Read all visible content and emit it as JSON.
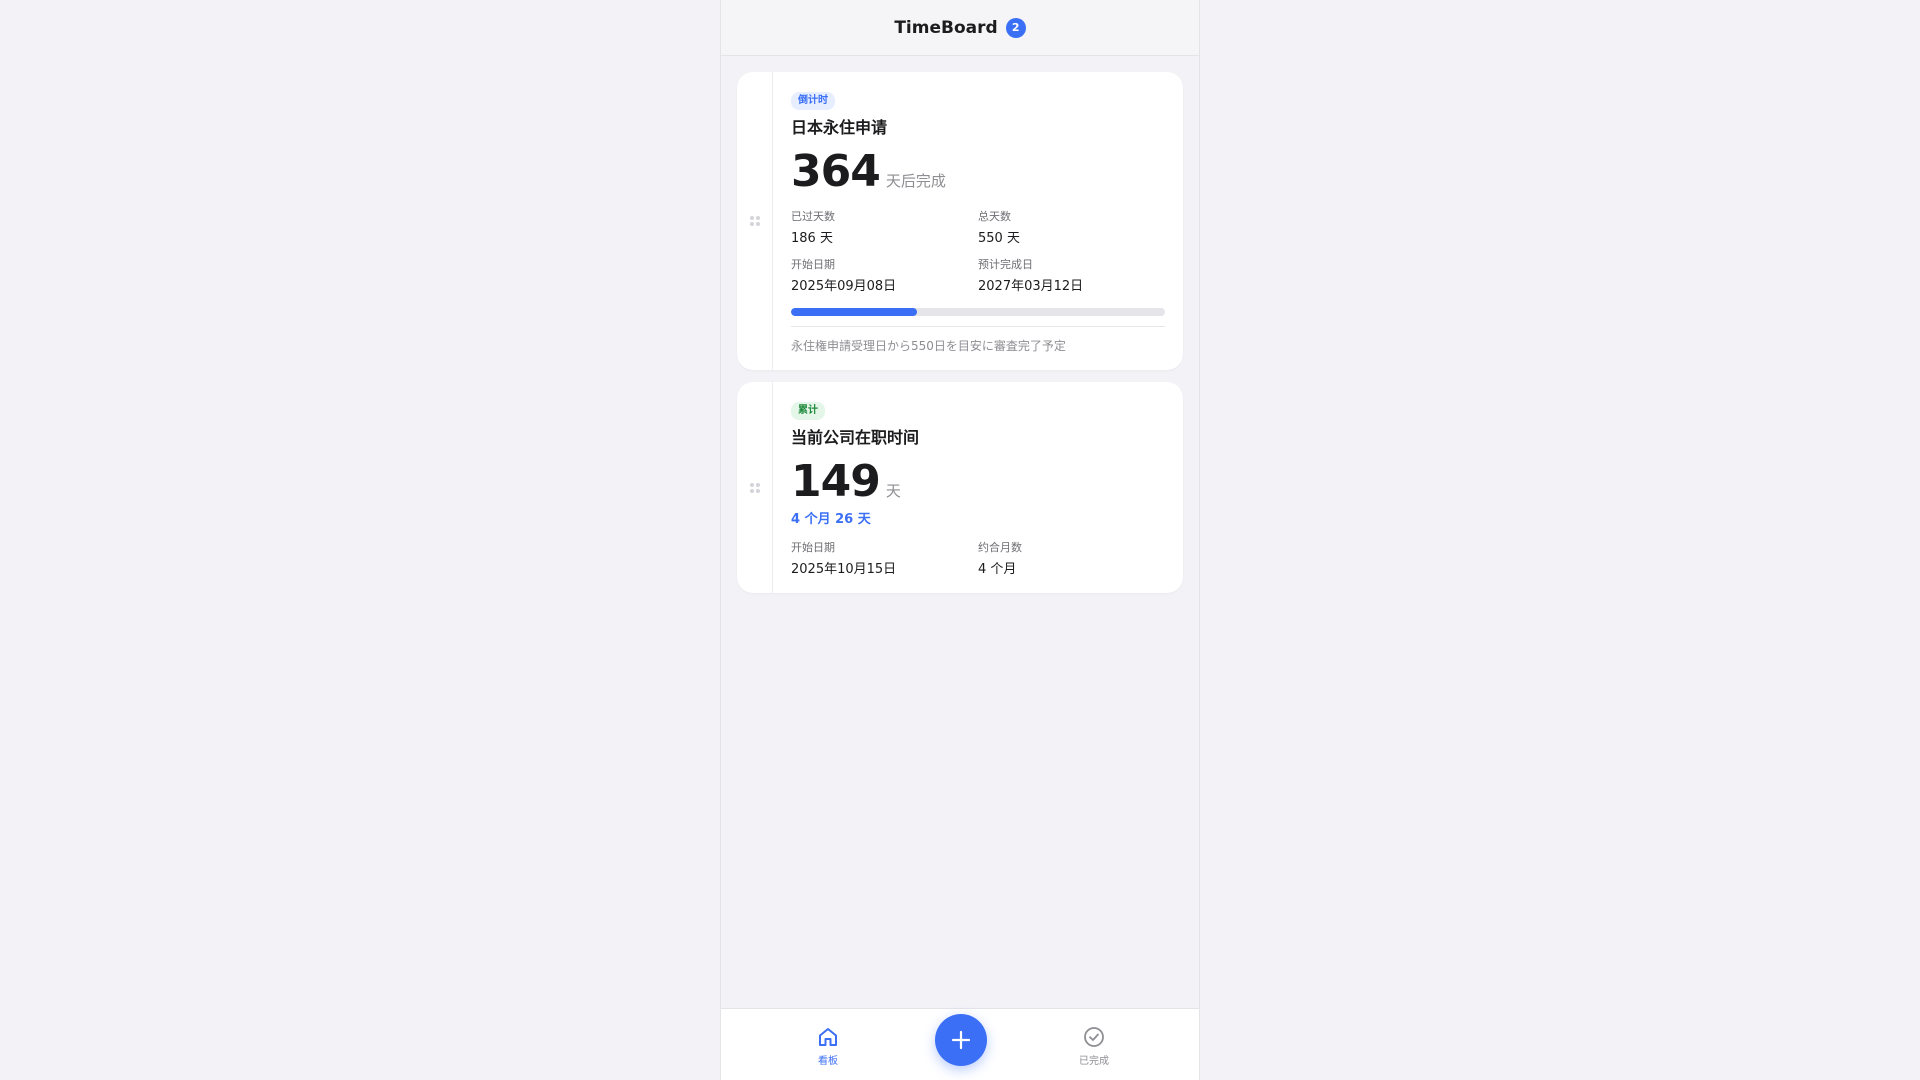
{
  "header": {
    "title": "TimeBoard",
    "badge": "2"
  },
  "cards": [
    {
      "tag": "倒计时",
      "title": "日本永住申请",
      "big_number": "364",
      "big_unit": "天后完成",
      "info": [
        {
          "label": "已过天数",
          "value": "186 天"
        },
        {
          "label": "总天数",
          "value": "550 天"
        },
        {
          "label": "开始日期",
          "value": "2025年09月08日"
        },
        {
          "label": "预计完成日",
          "value": "2027年03月12日"
        }
      ],
      "progress": 0.338,
      "note": "永住権申請受理日から550日を目安に審査完了予定"
    },
    {
      "tag": "累计",
      "title": "当前公司在职时间",
      "big_number": "149",
      "big_unit": "天",
      "sub": "4 个月 26 天",
      "info": [
        {
          "label": "开始日期",
          "value": "2025年10月15日"
        },
        {
          "label": "约合月数",
          "value": "4 个月"
        }
      ]
    }
  ],
  "tabbar": {
    "home_label": "看板",
    "done_label": "已完成",
    "home_icon": "home-icon",
    "add_icon": "plus-icon",
    "done_icon": "check-circle-icon"
  },
  "colors": {
    "accent": "#3b6ff5",
    "tag_green": "#1f8a3c",
    "background": "#f2f2f7"
  }
}
